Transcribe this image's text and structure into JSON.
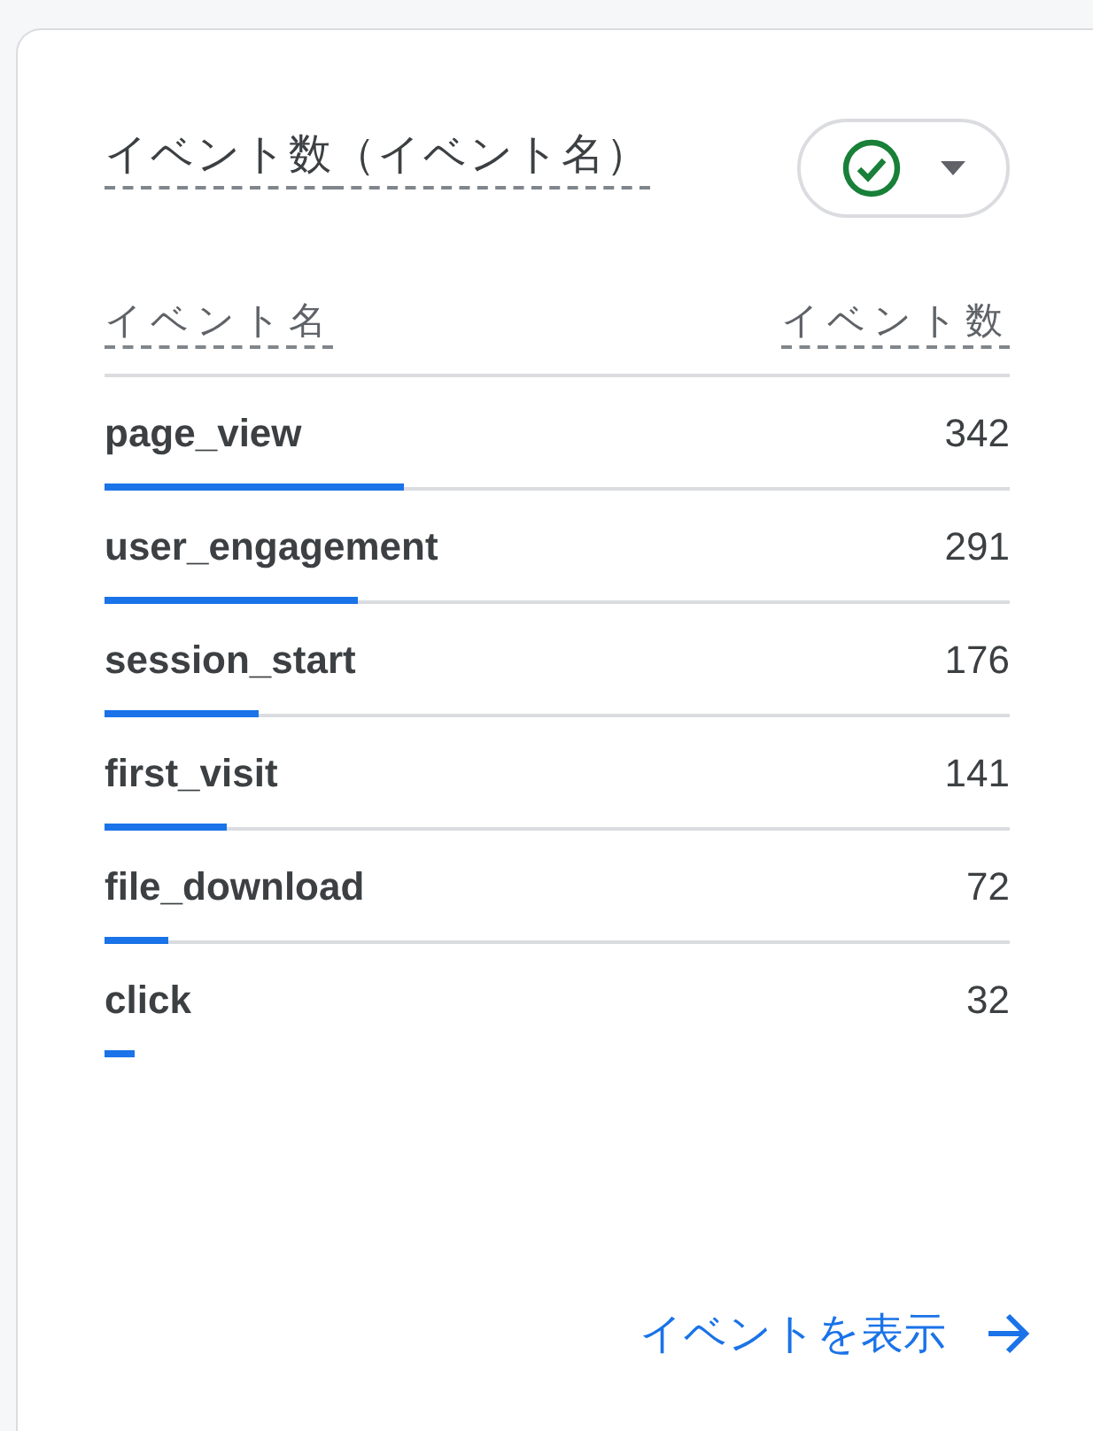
{
  "card": {
    "title": {
      "metric": "イベント数",
      "dimension": "（イベント名）"
    },
    "status_selector": {
      "checked": true
    },
    "table": {
      "columns": [
        "イベント名",
        "イベント数"
      ],
      "rows": [
        {
          "name": "page_view",
          "count": "342",
          "level": 0.33
        },
        {
          "name": "user_engagement",
          "count": "291",
          "level": 0.28
        },
        {
          "name": "session_start",
          "count": "176",
          "level": 0.17
        },
        {
          "name": "first_visit",
          "count": "141",
          "level": 0.135
        },
        {
          "name": "file_download",
          "count": "72",
          "level": 0.07
        },
        {
          "name": "click",
          "count": "32",
          "level": 0.033
        }
      ]
    },
    "link": "イベントを表示"
  }
}
